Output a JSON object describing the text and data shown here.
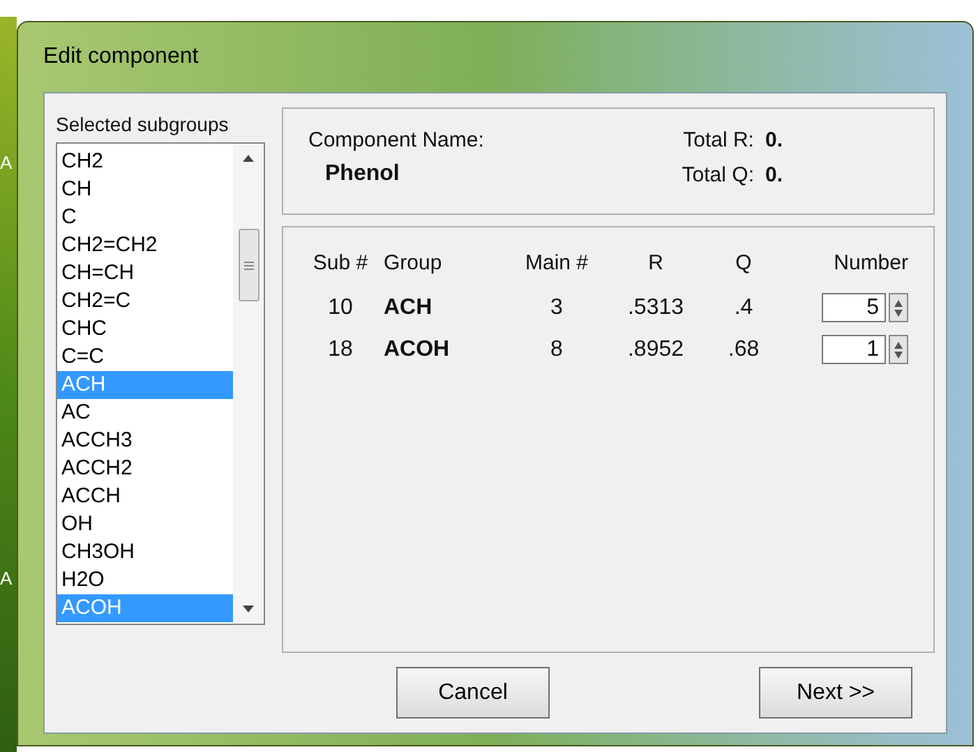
{
  "window": {
    "title": "Edit component"
  },
  "desktop_labels": [
    "A",
    "A"
  ],
  "subgroups": {
    "label": "Selected subgroups",
    "items": [
      {
        "text": "CH2",
        "selected": false
      },
      {
        "text": "CH",
        "selected": false
      },
      {
        "text": "C",
        "selected": false
      },
      {
        "text": "CH2=CH2",
        "selected": false
      },
      {
        "text": "CH=CH",
        "selected": false
      },
      {
        "text": "CH2=C",
        "selected": false
      },
      {
        "text": "CHC",
        "selected": false
      },
      {
        "text": "C=C",
        "selected": false
      },
      {
        "text": "ACH",
        "selected": true
      },
      {
        "text": "AC",
        "selected": false
      },
      {
        "text": "ACCH3",
        "selected": false
      },
      {
        "text": "ACCH2",
        "selected": false
      },
      {
        "text": "ACCH",
        "selected": false
      },
      {
        "text": "OH",
        "selected": false
      },
      {
        "text": "CH3OH",
        "selected": false
      },
      {
        "text": "H2O",
        "selected": false
      },
      {
        "text": "ACOH",
        "selected": true
      }
    ]
  },
  "component": {
    "name_label": "Component Name:",
    "name": "Phenol",
    "total_r_label": "Total R:",
    "total_r": "0.",
    "total_q_label": "Total Q:",
    "total_q": "0."
  },
  "table": {
    "columns": [
      "Sub #",
      "Group",
      "Main #",
      "R",
      "Q",
      "Number"
    ],
    "rows": [
      {
        "sub": "10",
        "group": "ACH",
        "main": "3",
        "r": ".5313",
        "q": ".4",
        "number": "5"
      },
      {
        "sub": "18",
        "group": "ACOH",
        "main": "8",
        "r": ".8952",
        "q": ".68",
        "number": "1"
      }
    ]
  },
  "buttons": [
    "Cancel",
    "Next >>"
  ]
}
